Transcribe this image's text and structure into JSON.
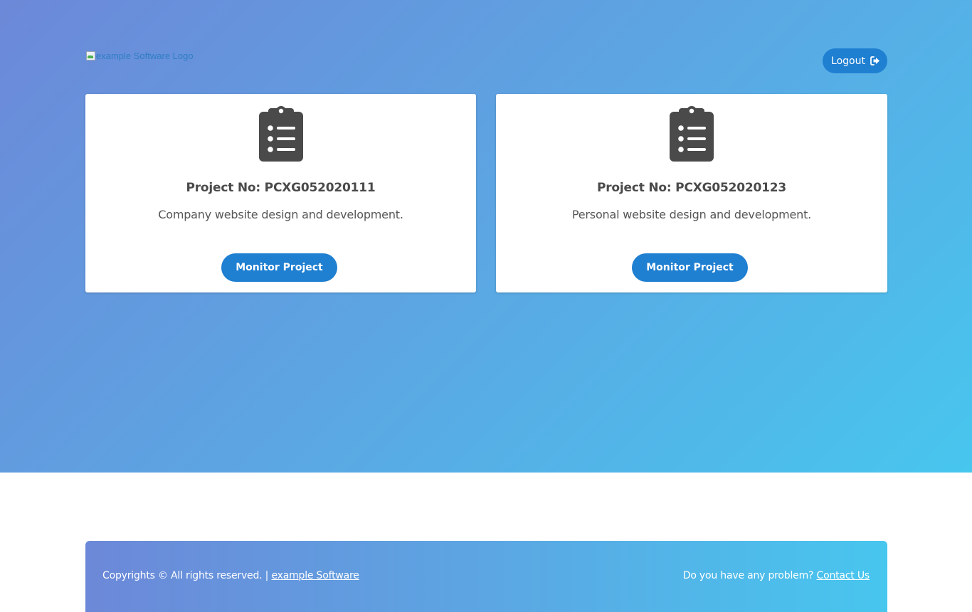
{
  "header": {
    "logo_alt": "example Software Logo",
    "logout_label": "Logout",
    "logout_icon": "sign-out-icon"
  },
  "projects": [
    {
      "icon": "clipboard-list-icon",
      "title": "Project No: PCXG052020111",
      "description": "Company website design and development.",
      "button_label": "Monitor Project"
    },
    {
      "icon": "clipboard-list-icon",
      "title": "Project No: PCXG052020123",
      "description": "Personal website design and development.",
      "button_label": "Monitor Project"
    }
  ],
  "footer": {
    "copyright_text": "Copyrights © All rights reserved. |",
    "company_link": "example Software",
    "problem_text": "Do you have any problem?",
    "contact_link": "Contact Us"
  },
  "colors": {
    "gradient_start": "#6c88d8",
    "gradient_end": "#47c6ee",
    "button_blue": "#1f7fd1",
    "icon_dark": "#4a4a4a"
  }
}
